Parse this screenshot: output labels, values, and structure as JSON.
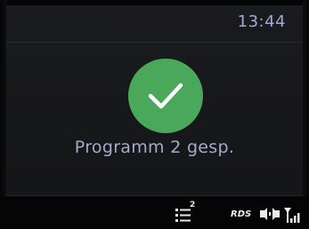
{
  "header": {
    "time": "13:44"
  },
  "confirmation": {
    "icon": "checkmark-icon",
    "message": "Programm 2 gesp."
  },
  "status_bar": {
    "list_icon": "list-icon",
    "list_badge": "2",
    "rds_label": "RDS",
    "stereo_icon": "stereo-icon",
    "signal_icon": "signal-strength-icon"
  },
  "colors": {
    "text": "#a9a8cc",
    "check_circle": "#4aa85a",
    "background": "#17181b",
    "status_bar": "#050506"
  }
}
